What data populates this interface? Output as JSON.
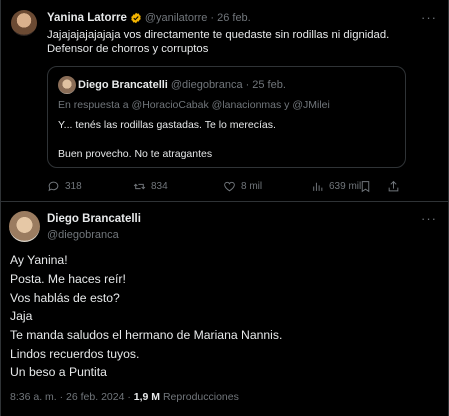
{
  "reply": {
    "author_name": "Yanina Latorre",
    "handle": "@yanilatorre",
    "dot": "·",
    "date": "26 feb.",
    "more": "···",
    "text_line1": "Jajajajajajajaja vos directamente te quedaste sin rodillas ni dignidad.",
    "text_line2": "Defensor de chorros y corruptos",
    "quote": {
      "author_name": "Diego Brancatelli",
      "handle": "@diegobranca",
      "dot": "·",
      "date": "25 feb.",
      "reply_to": "En respuesta a @HoracioCabak @lanacionmas y @JMilei",
      "line1": "Y... tenés las rodillas gastadas. Te lo merecías.",
      "line2": "Buen provecho. No te atragantes"
    },
    "actions": {
      "replies": "318",
      "reposts": "834",
      "likes": "8 mil",
      "views": "639 mil"
    }
  },
  "main": {
    "author_name": "Diego Brancatelli",
    "handle": "@diegobranca",
    "lines": [
      "Ay Yanina!",
      "Posta. Me haces reír!",
      "Vos hablás de esto?",
      "Jaja",
      "Te manda saludos el hermano de Mariana Nannis.",
      "Lindos recuerdos tuyos.",
      "Un beso a Puntita"
    ],
    "time": "8:36 a. m.",
    "dot": "·",
    "date": "26 feb. 2024",
    "views_count": "1,9 M",
    "views_label": "Reproducciones"
  },
  "colors": {
    "background": "#000000",
    "text": "#e7e9ea",
    "muted": "#71767b",
    "border": "#2f3336",
    "verified_badge": "#f4b400"
  }
}
